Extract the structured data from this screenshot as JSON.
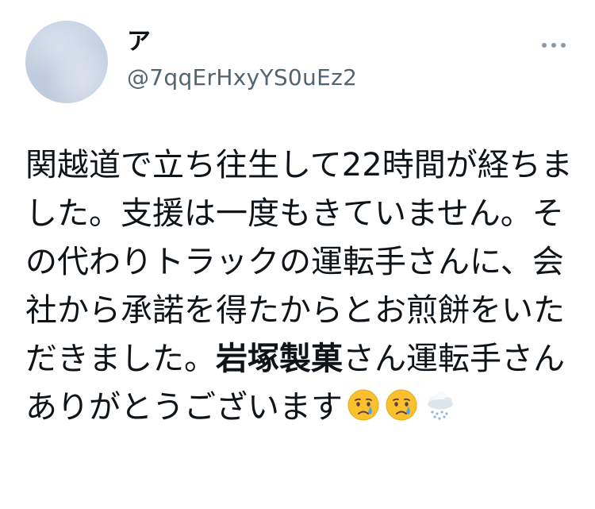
{
  "author": {
    "display_name": "ア",
    "handle": "@7qqErHxyYS0uEz2"
  },
  "tweet": {
    "text_part1": "関越道で立ち往生して22時間が経ちました。支援は一度もきていません。その代わりトラックの運転手さんに、会社から承諾を得たからとお煎餅をいただきました。",
    "text_bold": "岩塚製菓",
    "text_part2": "さん運転手さんありがとうございます",
    "emojis": [
      "crying-face-icon",
      "crying-face-icon",
      "cloud-with-snow-icon"
    ]
  },
  "colors": {
    "text": "#0f1419",
    "secondary_text": "#536471",
    "emoji_face": "#fbc02d",
    "tear": "#4fa3e0"
  }
}
